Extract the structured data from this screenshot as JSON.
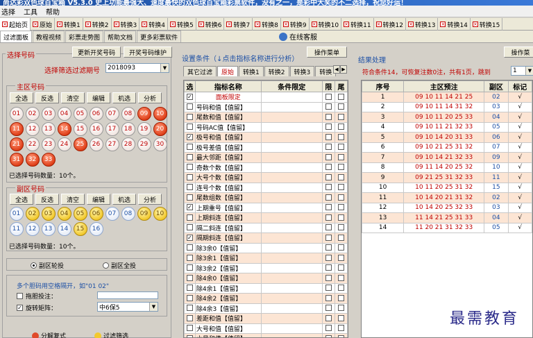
{
  "app": {
    "title": "尚达彩双色球百宝箱 V5.3.0  史上功能最强大、速度最快的双色球百宝箱彩票软件，没有之一，是彩中大奖的不二选择，祝您好运！"
  },
  "menu": [
    "选择",
    "工具",
    "帮助"
  ],
  "top_tabs": [
    "起始页",
    "原始",
    "转换1",
    "转换2",
    "转换3",
    "转换4",
    "转换5",
    "转换6",
    "转换7",
    "转换8",
    "转换9",
    "转换10",
    "转换11",
    "转换12",
    "转换13",
    "转换14",
    "转换15"
  ],
  "sub_tabs": [
    "过滤面板",
    "教程视频",
    "彩票走势图",
    "帮助文档",
    "更多彩票软件"
  ],
  "service_label": "在线客服",
  "left": {
    "section_title": "选择号码",
    "update_btn": "更新开奖号码",
    "maintain_btn": "开奖号码维护",
    "period_label": "选择筛选过滤期号",
    "period_value": "2018093",
    "red": {
      "title": "主区号码",
      "buttons": [
        "全选",
        "反选",
        "清空",
        "编辑",
        "机选",
        "分析"
      ],
      "numbers": [
        "01",
        "02",
        "03",
        "04",
        "05",
        "06",
        "07",
        "08",
        "09",
        "10",
        "11",
        "12",
        "13",
        "14",
        "15",
        "16",
        "17",
        "18",
        "19",
        "20",
        "21",
        "22",
        "23",
        "24",
        "25",
        "26",
        "27",
        "28",
        "29",
        "30",
        "31",
        "32",
        "33"
      ],
      "selected": [
        "09",
        "10",
        "11",
        "14",
        "20",
        "21",
        "25",
        "31",
        "32",
        "33"
      ],
      "count_text": "已选择号码数量：10个。"
    },
    "blue": {
      "title": "副区号码",
      "buttons": [
        "全选",
        "反选",
        "清空",
        "编辑",
        "机选",
        "分析"
      ],
      "numbers": [
        "01",
        "02",
        "03",
        "04",
        "05",
        "06",
        "07",
        "08",
        "09",
        "10",
        "11",
        "12",
        "13",
        "14",
        "15",
        "16"
      ],
      "selected": [
        "02",
        "03",
        "04",
        "05",
        "06",
        "09",
        "10",
        "15"
      ],
      "count_text": "已选择号码数量：10个。"
    },
    "radio_left": "副区轮投",
    "radio_right": "副区全投",
    "hint": "多个胆码用空格隔开，如\"01 02\"",
    "dan_label": "拖胆投注：",
    "wheel_label": "旋转矩阵：",
    "wheel_value": "中6保5",
    "bottom_btn1": "分解复式",
    "bottom_btn2": "过滤筛选"
  },
  "middle": {
    "section_title": "设置条件（↓点击指标名称进行分析）",
    "ops_btn": "操作菜单",
    "tabs": [
      "其它过滤",
      "原始",
      "转换1",
      "转换2",
      "转换3",
      "转换"
    ],
    "headers": [
      "选",
      "指标名称",
      "条件限定",
      "限",
      "尾"
    ],
    "rows": [
      {
        "name": "面板限定",
        "checked": true,
        "special": true
      },
      {
        "name": "号码和值【值留】",
        "checked": false
      },
      {
        "name": "尾数和值【值留】",
        "checked": false
      },
      {
        "name": "号码AC值【值留】",
        "checked": false
      },
      {
        "name": "极号和值【值留】",
        "checked": true
      },
      {
        "name": "极号差值【值留】",
        "checked": false
      },
      {
        "name": "最大邻距【值留】",
        "checked": false
      },
      {
        "name": "奇数个数【值留】",
        "checked": false
      },
      {
        "name": "大号个数【值留】",
        "checked": false
      },
      {
        "name": "连号个数【值留】",
        "checked": false
      },
      {
        "name": "尾数组数【值留】",
        "checked": false
      },
      {
        "name": "上期重号【值留】",
        "checked": true
      },
      {
        "name": "上期斜连【值留】",
        "checked": false
      },
      {
        "name": "隔二斜连【值留】",
        "checked": false
      },
      {
        "name": "隔期斜连【值留】",
        "checked": true
      },
      {
        "name": "除3余0【值留】",
        "checked": false
      },
      {
        "name": "除3余1【值留】",
        "checked": false
      },
      {
        "name": "除3余2【值留】",
        "checked": false
      },
      {
        "name": "除4余0【值留】",
        "checked": false
      },
      {
        "name": "除4余1【值留】",
        "checked": false
      },
      {
        "name": "除4余2【值留】",
        "checked": false
      },
      {
        "name": "除4余3【值留】",
        "checked": false
      },
      {
        "name": "差距和值【值留】",
        "checked": false
      },
      {
        "name": "大号和值【值留】",
        "checked": false
      },
      {
        "name": "小号和值【值留】",
        "checked": false
      }
    ]
  },
  "right": {
    "section_title": "结果处理",
    "ops_btn": "操作菜",
    "summary": "符合条件14，可恢复注数0注，共有1页，跳到",
    "page_value": "1",
    "headers": [
      "序号",
      "主区预注",
      "副区",
      "标记"
    ],
    "rows": [
      {
        "i": "1",
        "nums": "09 10 11 14 21 25",
        "blue": "02",
        "mark": "√"
      },
      {
        "i": "2",
        "nums": "09 10 11 14 31 32",
        "blue": "03",
        "mark": "√"
      },
      {
        "i": "3",
        "nums": "09 10 11 20 25 33",
        "blue": "04",
        "mark": "√"
      },
      {
        "i": "4",
        "nums": "09 10 11 21 32 33",
        "blue": "05",
        "mark": "√"
      },
      {
        "i": "5",
        "nums": "09 10 14 20 31 33",
        "blue": "06",
        "mark": "√"
      },
      {
        "i": "6",
        "nums": "09 10 21 25 31 32",
        "blue": "07",
        "mark": "√"
      },
      {
        "i": "7",
        "nums": "09 10 14 21 32 33",
        "blue": "09",
        "mark": "√"
      },
      {
        "i": "8",
        "nums": "09 11 14 20 25 32",
        "blue": "10",
        "mark": "√"
      },
      {
        "i": "9",
        "nums": "09 21 25 31 32 33",
        "blue": "11",
        "mark": "√"
      },
      {
        "i": "10",
        "nums": "10 11 20 25 31 32",
        "blue": "15",
        "mark": "√"
      },
      {
        "i": "11",
        "nums": "10 14 20 21 31 32",
        "blue": "02",
        "mark": "√"
      },
      {
        "i": "12",
        "nums": "10 14 20 25 32 33",
        "blue": "03",
        "mark": "√"
      },
      {
        "i": "13",
        "nums": "11 14 21 25 31 33",
        "blue": "04",
        "mark": "√"
      },
      {
        "i": "14",
        "nums": "11 20 21 31 32 33",
        "blue": "05",
        "mark": "√"
      }
    ]
  },
  "watermark": "最需教育"
}
